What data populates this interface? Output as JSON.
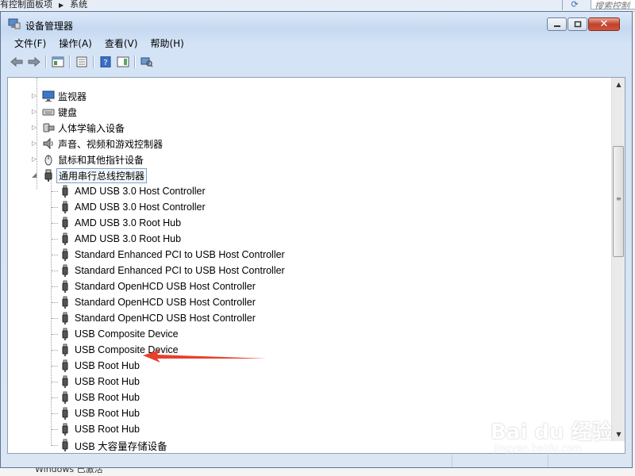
{
  "background": {
    "breadcrumb": [
      "有控制面板项",
      "系统"
    ],
    "search_placeholder": "搜索控制",
    "activation_text": "Windows 已激活"
  },
  "window": {
    "title": "设备管理器",
    "menu": [
      "文件(F)",
      "操作(A)",
      "查看(V)",
      "帮助(H)"
    ]
  },
  "toolbar": {
    "buttons": [
      "back-icon",
      "forward-icon",
      "console-tree-icon",
      "properties-icon",
      "help-icon",
      "view-icon",
      "scan-hardware-icon"
    ]
  },
  "tree": {
    "categories": [
      {
        "label": "监视器",
        "icon": "monitor-icon",
        "expanded": false
      },
      {
        "label": "键盘",
        "icon": "keyboard-icon",
        "expanded": false
      },
      {
        "label": "人体学输入设备",
        "icon": "hid-icon",
        "expanded": false
      },
      {
        "label": "声音、视频和游戏控制器",
        "icon": "speaker-icon",
        "expanded": false
      },
      {
        "label": "鼠标和其他指针设备",
        "icon": "mouse-icon",
        "expanded": false
      },
      {
        "label": "通用串行总线控制器",
        "icon": "usb-icon",
        "expanded": true
      }
    ],
    "usb_devices": [
      "AMD USB 3.0 Host Controller",
      "AMD USB 3.0 Host Controller",
      "AMD USB 3.0 Root Hub",
      "AMD USB 3.0 Root Hub",
      "Standard Enhanced PCI to USB Host Controller",
      "Standard Enhanced PCI to USB Host Controller",
      "Standard OpenHCD USB Host Controller",
      "Standard OpenHCD USB Host Controller",
      "Standard OpenHCD USB Host Controller",
      "USB Composite Device",
      "USB Composite Device",
      "USB Root Hub",
      "USB Root Hub",
      "USB Root Hub",
      "USB Root Hub",
      "USB Root Hub",
      "USB 大容量存储设备"
    ],
    "highlighted_device_index": 11
  },
  "annotation": {
    "type": "red-arrow",
    "color": "#e8402c"
  },
  "watermark": {
    "brand": "Bai du 经验",
    "url": "jingyan.baidu.com"
  }
}
